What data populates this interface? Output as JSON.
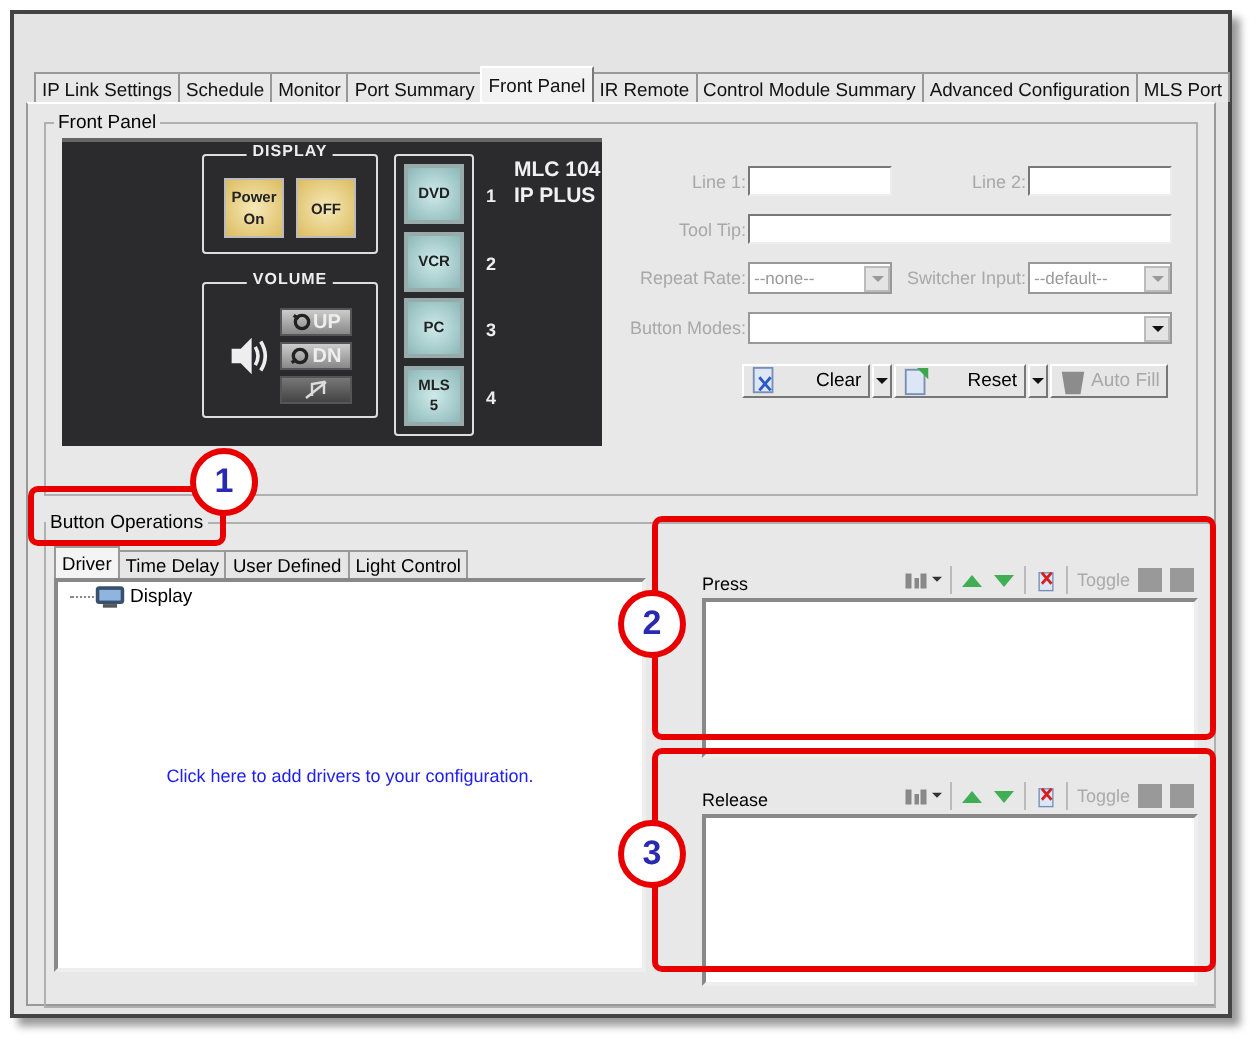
{
  "tabs": [
    {
      "label": "IP Link Settings",
      "selected": false
    },
    {
      "label": "Schedule",
      "selected": false
    },
    {
      "label": "Monitor",
      "selected": false
    },
    {
      "label": "Port Summary",
      "selected": false
    },
    {
      "label": "Front Panel",
      "selected": true
    },
    {
      "label": "IR Remote",
      "selected": false
    },
    {
      "label": "Control Module Summary",
      "selected": false
    },
    {
      "label": "Advanced Configuration",
      "selected": false
    },
    {
      "label": "MLS Port",
      "selected": false
    }
  ],
  "front_panel": {
    "title": "Front Panel",
    "device": {
      "model_lines": [
        "MLC 104",
        "IP PLUS"
      ],
      "display_group": {
        "title": "DISPLAY",
        "buttons": [
          "Power On",
          "OFF"
        ]
      },
      "volume_group": {
        "title": "VOLUME",
        "buttons": [
          {
            "kind": "up",
            "label": "UP"
          },
          {
            "kind": "down",
            "label": "DN"
          },
          {
            "kind": "mute"
          }
        ]
      },
      "inputs": [
        {
          "label": "DVD",
          "number": "1"
        },
        {
          "label": "VCR",
          "number": "2"
        },
        {
          "label": "PC",
          "number": "3"
        },
        {
          "label": "MLS 5",
          "number": "4"
        }
      ]
    },
    "form": {
      "line1": {
        "label": "Line 1:",
        "disabled": true
      },
      "line2": {
        "label": "Line 2:",
        "disabled": true
      },
      "tool_tip": {
        "label": "Tool Tip:",
        "disabled": true
      },
      "repeat_rate": {
        "label": "Repeat Rate:",
        "value": "--none--",
        "disabled": true
      },
      "switcher_input": {
        "label": "Switcher Input:",
        "value": "--default--",
        "disabled": true
      },
      "button_modes": {
        "label": "Button Modes:",
        "disabled": true
      }
    },
    "buttons": [
      {
        "kind": "clear",
        "label": "Clear",
        "disabled": false,
        "split": true
      },
      {
        "kind": "reset",
        "label": "Reset",
        "disabled": false,
        "split": true
      },
      {
        "kind": "autofill",
        "label": "Auto Fill",
        "disabled": true,
        "split": false
      }
    ]
  },
  "button_operations": {
    "title": "Button Operations",
    "tabs": [
      {
        "label": "Driver",
        "selected": true
      },
      {
        "label": "Time Delay",
        "selected": false
      },
      {
        "label": "User Defined",
        "selected": false
      },
      {
        "label": "Light Control",
        "selected": false
      }
    ],
    "tree": [
      {
        "label": "Display"
      }
    ],
    "hint": "Click here to add drivers to your configuration.",
    "sections": [
      {
        "title": "Press",
        "toggle": "Toggle",
        "toggle_disabled": true
      },
      {
        "title": "Release",
        "toggle": "Toggle",
        "toggle_disabled": true
      }
    ]
  },
  "callouts": [
    {
      "number": "1"
    },
    {
      "number": "2"
    },
    {
      "number": "3"
    }
  ]
}
